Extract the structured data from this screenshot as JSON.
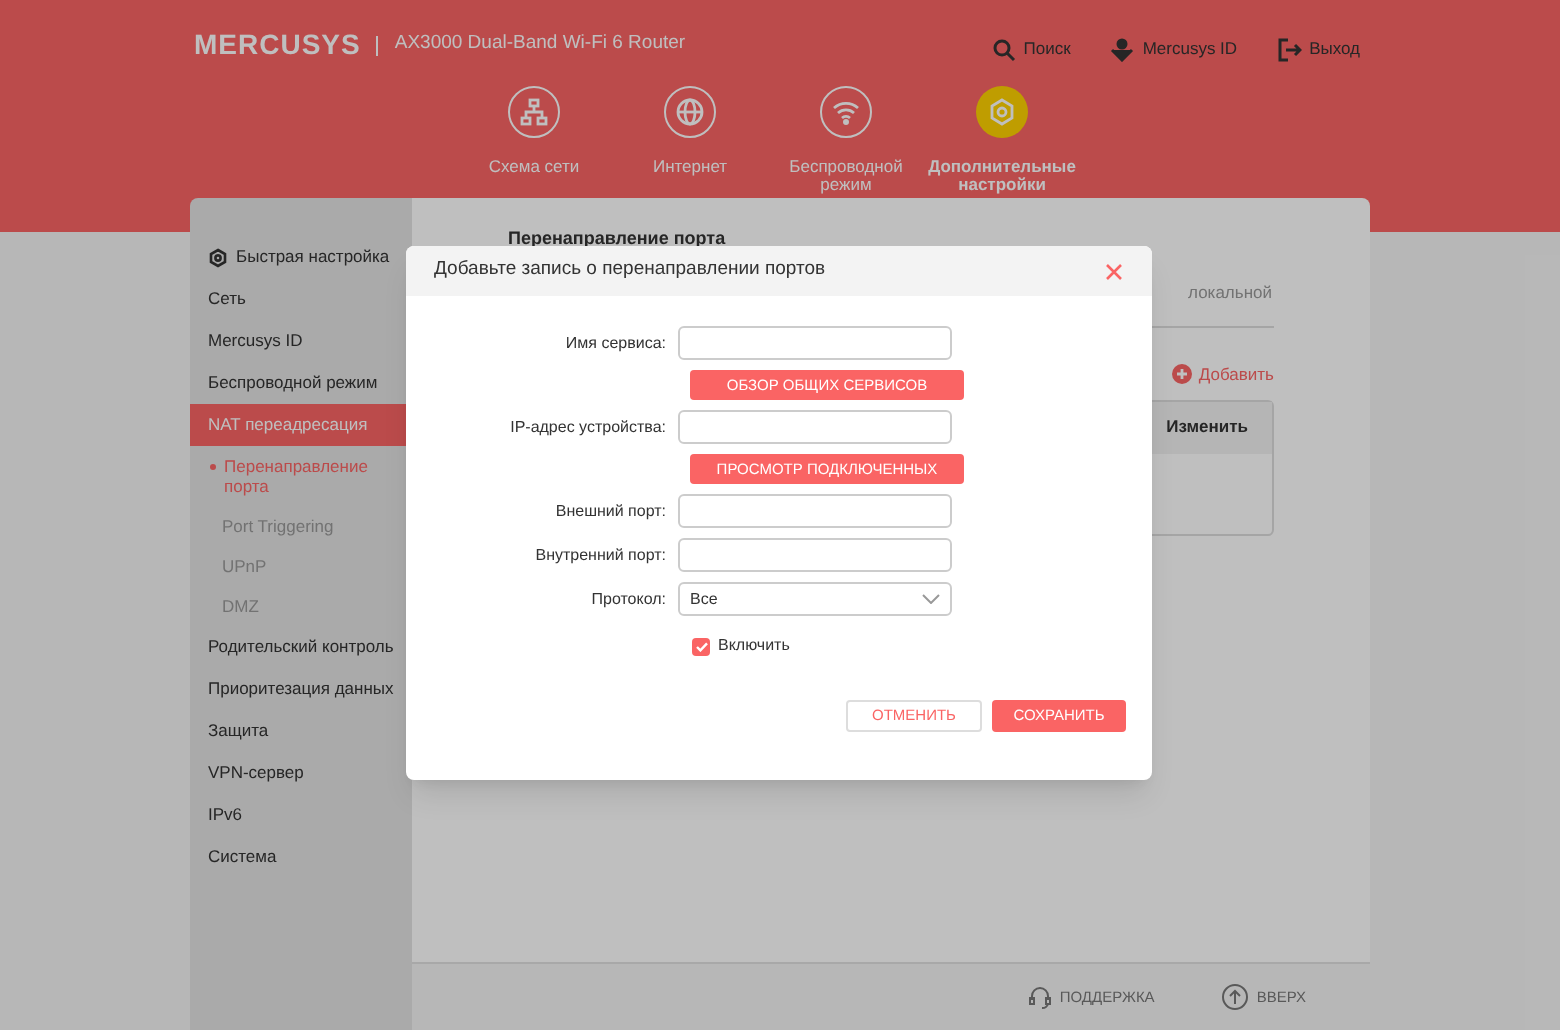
{
  "header": {
    "logo": "MERCUSYS",
    "model": "AX3000 Dual-Band Wi-Fi 6 Router",
    "links": [
      {
        "kind": "search",
        "label": "Поиск"
      },
      {
        "kind": "id",
        "label": "Mercusys ID"
      },
      {
        "kind": "logout",
        "label": "Выход"
      }
    ]
  },
  "nav": [
    {
      "kind": "network",
      "label": "Схема сети",
      "selected": false
    },
    {
      "kind": "internet",
      "label": "Интернет",
      "selected": false
    },
    {
      "kind": "wireless",
      "label": "Беспроводной режим",
      "selected": false
    },
    {
      "kind": "advanced",
      "label": "Дополнительные настройки",
      "selected": true
    }
  ],
  "sidebar": {
    "items": [
      {
        "label": "Быстрая настройка",
        "icon": true,
        "selected": false
      },
      {
        "label": "Сеть",
        "selected": false
      },
      {
        "label": "Mercusys ID",
        "selected": false
      },
      {
        "label": "Беспроводной режим",
        "selected": false
      },
      {
        "label": "NAT переадресация",
        "selected": true,
        "children": [
          {
            "label": "Перенаправление порта",
            "selected": true
          },
          {
            "label": "Port Triggering",
            "selected": false
          },
          {
            "label": "UPnP",
            "selected": false
          },
          {
            "label": "DMZ",
            "selected": false
          }
        ]
      },
      {
        "label": "Родительский контроль",
        "selected": false
      },
      {
        "label": "Приоритезация данных",
        "selected": false
      },
      {
        "label": "Защита",
        "selected": false
      },
      {
        "label": "VPN-сервер",
        "selected": false
      },
      {
        "label": "IPv6",
        "selected": false
      },
      {
        "label": "Система",
        "selected": false
      }
    ]
  },
  "content": {
    "title": "Перенаправление порта",
    "description_fragment": "локальной",
    "add_button": "Добавить",
    "table_column": "Изменить"
  },
  "footer": {
    "support": "ПОДДЕРЖКА",
    "top": "ВВЕРХ"
  },
  "dialog": {
    "title": "Добавьте запись о перенаправлении портов",
    "fields": [
      {
        "kind": "input",
        "label": "Имя сервиса:",
        "button": "ОБЗОР ОБЩИХ СЕРВИСОВ"
      },
      {
        "kind": "input",
        "label": "IP-адрес устройства:",
        "button": "ПРОСМОТР ПОДКЛЮЧЕННЫХ"
      },
      {
        "kind": "input",
        "label": "Внешний порт:"
      },
      {
        "kind": "input",
        "label": "Внутренний порт:"
      },
      {
        "kind": "select",
        "label": "Протокол:",
        "value": "Все"
      }
    ],
    "enable": {
      "label": "Включить",
      "checked": true
    },
    "buttons": {
      "cancel": "ОТМЕНИТЬ",
      "save": "СОХРАНИТЬ"
    }
  }
}
